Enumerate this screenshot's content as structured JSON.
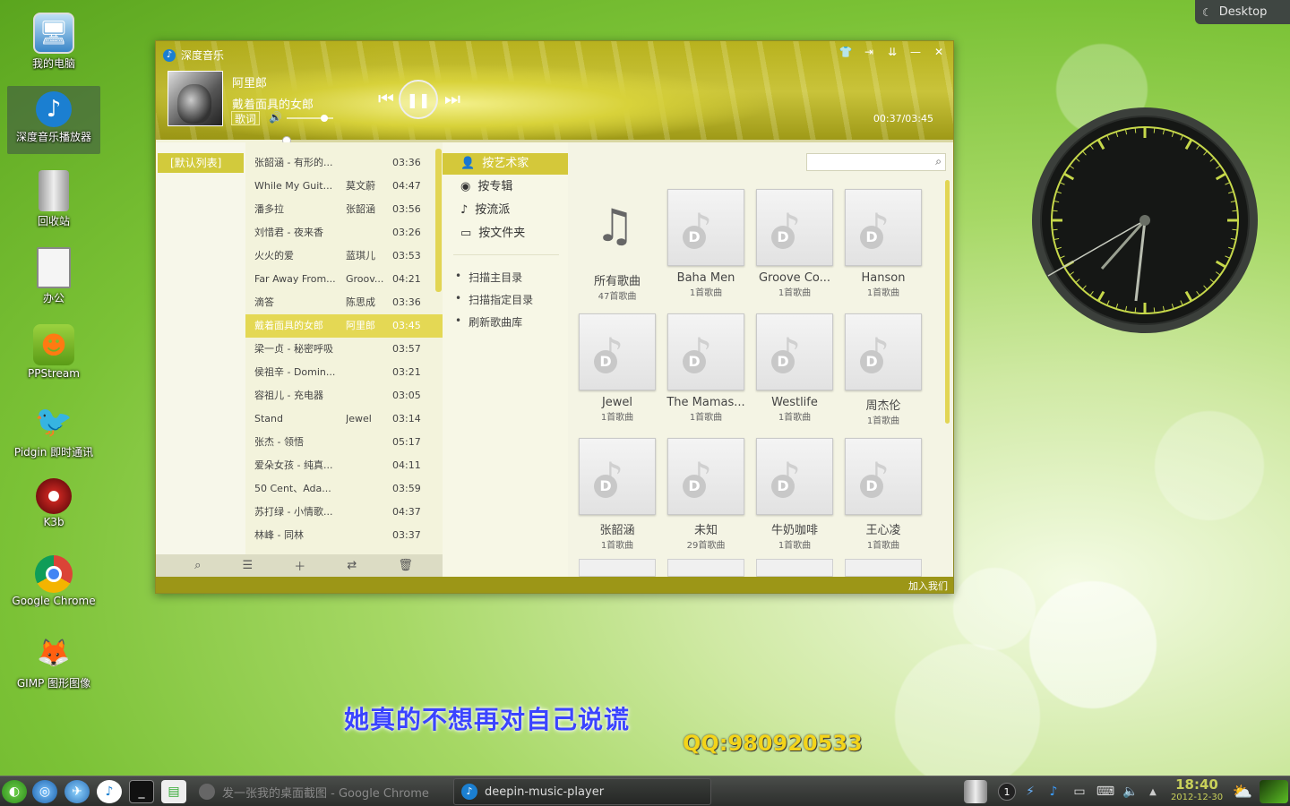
{
  "desktop": {
    "icons": [
      {
        "label": "我的电脑",
        "icon": "computer-icon"
      },
      {
        "label": "深度音乐播放器",
        "icon": "deepin-music-icon"
      },
      {
        "label": "回收站",
        "icon": "trash-icon"
      },
      {
        "label": "办公",
        "icon": "document-icon"
      },
      {
        "label": "PPStream",
        "icon": "ppstream-icon"
      },
      {
        "label": "Pidgin 即时通讯",
        "icon": "pidgin-icon"
      },
      {
        "label": "K3b",
        "icon": "k3b-icon"
      },
      {
        "label": "Google Chrome",
        "icon": "chrome-icon"
      },
      {
        "label": "GIMP 图形图像",
        "icon": "gimp-icon"
      }
    ],
    "badge": "Desktop"
  },
  "player": {
    "title": "深度音乐",
    "now_playing": {
      "artist": "阿里郎",
      "title": "戴着面具的女郎",
      "lyric_button": "歌词",
      "time": "00:37/03:45",
      "progress": 0.164,
      "volume": 0.8
    },
    "list_tab": "[默认列表]",
    "songs": [
      {
        "title": "张韶涵 - 有形的...",
        "artist": "",
        "duration": "03:36"
      },
      {
        "title": "While My Guit...",
        "artist": "莫文蔚",
        "duration": "04:47"
      },
      {
        "title": "潘多拉",
        "artist": "张韶涵",
        "duration": "03:56"
      },
      {
        "title": "刘惜君 - 夜来香",
        "artist": "",
        "duration": "03:26"
      },
      {
        "title": "火火的爱",
        "artist": "蓝琪儿",
        "duration": "03:53"
      },
      {
        "title": "Far Away From...",
        "artist": "Groov...",
        "duration": "04:21"
      },
      {
        "title": "滴答",
        "artist": "陈思成",
        "duration": "03:36"
      },
      {
        "title": "戴着面具的女郎",
        "artist": "阿里郎",
        "duration": "03:45"
      },
      {
        "title": "梁一贞 - 秘密呼吸",
        "artist": "",
        "duration": "03:57"
      },
      {
        "title": "侯祖辛 - Domin...",
        "artist": "",
        "duration": "03:21"
      },
      {
        "title": "容祖儿 - 充电器",
        "artist": "",
        "duration": "03:05"
      },
      {
        "title": "Stand",
        "artist": "Jewel",
        "duration": "03:14"
      },
      {
        "title": "张杰 - 领悟",
        "artist": "",
        "duration": "05:17"
      },
      {
        "title": "爱朵女孩 - 纯真...",
        "artist": "",
        "duration": "04:11"
      },
      {
        "title": "50 Cent、Ada...",
        "artist": "",
        "duration": "03:59"
      },
      {
        "title": "苏打绿 - 小情歌...",
        "artist": "",
        "duration": "04:37"
      },
      {
        "title": "林峰 - 同林",
        "artist": "",
        "duration": "03:37"
      }
    ],
    "active_song_index": 7,
    "categories": [
      {
        "label": "按艺术家",
        "icon": "person-icon"
      },
      {
        "label": "按专辑",
        "icon": "disc-icon"
      },
      {
        "label": "按流派",
        "icon": "guitar-icon"
      },
      {
        "label": "按文件夹",
        "icon": "monitor-icon"
      }
    ],
    "operations": [
      "扫描主目录",
      "扫描指定目录",
      "刷新歌曲库"
    ],
    "albums": [
      {
        "name": "所有歌曲",
        "count": "47首歌曲"
      },
      {
        "name": "Baha Men",
        "count": "1首歌曲"
      },
      {
        "name": "Groove Co...",
        "count": "1首歌曲"
      },
      {
        "name": "Hanson",
        "count": "1首歌曲"
      },
      {
        "name": "Jewel",
        "count": "1首歌曲"
      },
      {
        "name": "The Mamas...",
        "count": "1首歌曲"
      },
      {
        "name": "Westlife",
        "count": "1首歌曲"
      },
      {
        "name": "周杰伦",
        "count": "1首歌曲"
      },
      {
        "name": "张韶涵",
        "count": "1首歌曲"
      },
      {
        "name": "未知",
        "count": "29首歌曲"
      },
      {
        "name": "牛奶咖啡",
        "count": "1首歌曲"
      },
      {
        "name": "王心凌",
        "count": "1首歌曲"
      }
    ],
    "status_link": "加入我们"
  },
  "overlay": {
    "lyric": "她真的不想再对自己说谎",
    "qq": "QQ:980920533"
  },
  "taskbar": {
    "tasks": [
      {
        "label": "发一张我的桌面截图 - Google Chrome",
        "active": false
      },
      {
        "label": "deepin-music-player",
        "active": true
      }
    ],
    "workspace": "1",
    "time": "18:40",
    "date": "2012-12-30"
  },
  "colors": {
    "accent": "#d4c83a",
    "titlebar": "#b8b21e",
    "lyric": "#3b44ff",
    "qq": "#f3d41a"
  }
}
